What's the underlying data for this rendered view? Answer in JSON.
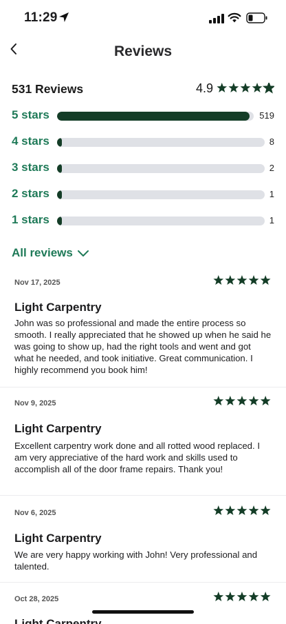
{
  "status_bar": {
    "time": "11:29"
  },
  "nav": {
    "title": "Reviews",
    "back_icon": "chevron-left-icon"
  },
  "summary": {
    "count_label": "531 Reviews",
    "average": "4.9",
    "average_stars": 4.9
  },
  "distribution": [
    {
      "label": "5 stars",
      "count": "519",
      "fraction": 0.978
    },
    {
      "label": "4 stars",
      "count": "8",
      "fraction": 0.015
    },
    {
      "label": "3 stars",
      "count": "2",
      "fraction": 0.004
    },
    {
      "label": "2 stars",
      "count": "1",
      "fraction": 0.002
    },
    {
      "label": "1 stars",
      "count": "1",
      "fraction": 0.002
    }
  ],
  "all_reviews": {
    "label": "All reviews",
    "icon": "chevron-down-icon"
  },
  "reviews": [
    {
      "date": "Nov 17, 2025",
      "rating": 5,
      "title": "Light Carpentry",
      "body": "John was so professional and made the entire process so smooth. I really appreciated that he showed up when he said he was going to show up, had the right tools and went and got what he needed, and took initiative. Great communication. I highly recommend you book him!"
    },
    {
      "date": "Nov 9, 2025",
      "rating": 5,
      "title": "Light Carpentry",
      "body": "Excellent carpentry work done and all rotted wood replaced. I am very appreciative of the hard work and skills used to accomplish all of the door frame repairs. Thank you!"
    },
    {
      "date": "Nov 6, 2025",
      "rating": 5,
      "title": "Light Carpentry",
      "body": "We are very happy working with John! Very professional and talented."
    },
    {
      "date": "Oct 28, 2025",
      "rating": 5,
      "title": "Light Carpentry",
      "body": ""
    }
  ],
  "colors": {
    "accent_green": "#1f7a58",
    "bar_fill": "#143d27",
    "star": "#143d27",
    "track": "#dfe1e6"
  }
}
